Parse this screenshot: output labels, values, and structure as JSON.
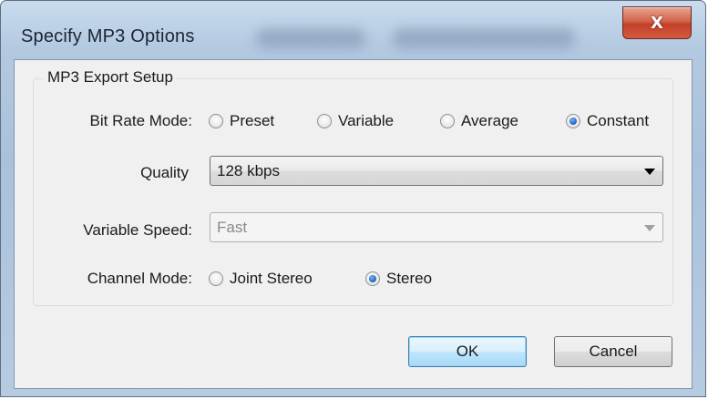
{
  "window": {
    "title": "Specify MP3 Options",
    "close_glyph": "X"
  },
  "group": {
    "title": "MP3 Export Setup"
  },
  "bit_rate_mode": {
    "label": "Bit Rate Mode:",
    "options": [
      "Preset",
      "Variable",
      "Average",
      "Constant"
    ],
    "selected": "Constant"
  },
  "quality": {
    "label": "Quality",
    "value": "128 kbps"
  },
  "variable_speed": {
    "label": "Variable Speed:",
    "value": "Fast",
    "enabled": false
  },
  "channel_mode": {
    "label": "Channel Mode:",
    "options": [
      "Joint Stereo",
      "Stereo"
    ],
    "selected": "Stereo"
  },
  "buttons": {
    "ok": "OK",
    "cancel": "Cancel"
  },
  "icons": {
    "close": "close-icon",
    "dropdown": "chevron-down-icon"
  },
  "colors": {
    "client_bg": "#f0f0f0",
    "radio_selected": "#2b6fc7",
    "close_button": "#c24028",
    "default_button_border": "#3c7fb1"
  }
}
